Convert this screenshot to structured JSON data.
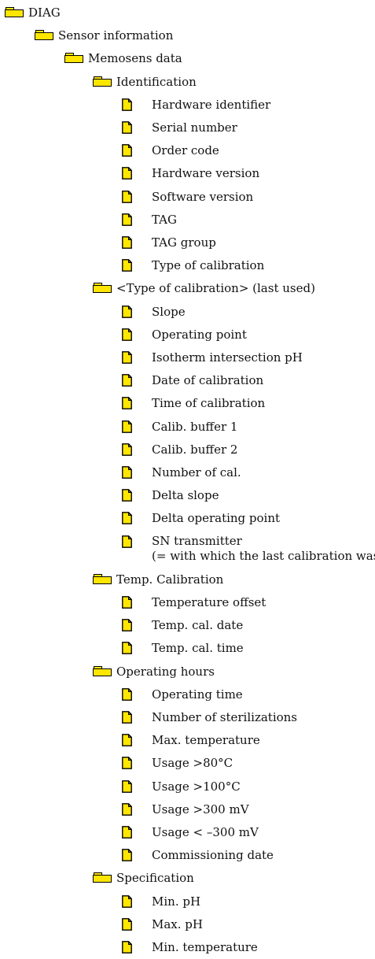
{
  "colors": {
    "folder_fill": "#ffe600",
    "file_fill": "#ffe600",
    "outline": "#000000"
  },
  "tree": [
    {
      "type": "folder",
      "level": 0,
      "label": "DIAG"
    },
    {
      "type": "folder",
      "level": 1,
      "label": "Sensor information"
    },
    {
      "type": "folder",
      "level": 2,
      "label": "Memosens data"
    },
    {
      "type": "folder",
      "level": 3,
      "label": "Identification"
    },
    {
      "type": "file",
      "level": 4,
      "label": "Hardware identifier"
    },
    {
      "type": "file",
      "level": 4,
      "label": "Serial number"
    },
    {
      "type": "file",
      "level": 4,
      "label": "Order code"
    },
    {
      "type": "file",
      "level": 4,
      "label": "Hardware version"
    },
    {
      "type": "file",
      "level": 4,
      "label": "Software version"
    },
    {
      "type": "file",
      "level": 4,
      "label": "TAG"
    },
    {
      "type": "file",
      "level": 4,
      "label": "TAG group"
    },
    {
      "type": "file",
      "level": 4,
      "label": "Type of calibration"
    },
    {
      "type": "folder",
      "level": 3,
      "label": "<Type of calibration> (last used)"
    },
    {
      "type": "file",
      "level": 4,
      "label": "Slope"
    },
    {
      "type": "file",
      "level": 4,
      "label": "Operating point"
    },
    {
      "type": "file",
      "level": 4,
      "label": "Isotherm intersection pH"
    },
    {
      "type": "file",
      "level": 4,
      "label": "Date of calibration"
    },
    {
      "type": "file",
      "level": 4,
      "label": "Time of calibration"
    },
    {
      "type": "file",
      "level": 4,
      "label": "Calib. buffer 1"
    },
    {
      "type": "file",
      "level": 4,
      "label": "Calib. buffer 2"
    },
    {
      "type": "file",
      "level": 4,
      "label": "Number of cal."
    },
    {
      "type": "file",
      "level": 4,
      "label": "Delta slope"
    },
    {
      "type": "file",
      "level": 4,
      "label": "Delta operating point"
    },
    {
      "type": "file",
      "level": 4,
      "label": "SN transmitter",
      "label2": "(= with which the last calibration was)"
    },
    {
      "type": "folder",
      "level": 3,
      "label": "Temp. Calibration"
    },
    {
      "type": "file",
      "level": 4,
      "label": "Temperature offset"
    },
    {
      "type": "file",
      "level": 4,
      "label": "Temp. cal. date"
    },
    {
      "type": "file",
      "level": 4,
      "label": "Temp. cal. time"
    },
    {
      "type": "folder",
      "level": 3,
      "label": "Operating hours"
    },
    {
      "type": "file",
      "level": 4,
      "label": "Operating time"
    },
    {
      "type": "file",
      "level": 4,
      "label": "Number of sterilizations"
    },
    {
      "type": "file",
      "level": 4,
      "label": "Max. temperature"
    },
    {
      "type": "file",
      "level": 4,
      "label": "Usage >80°C"
    },
    {
      "type": "file",
      "level": 4,
      "label": "Usage >100°C"
    },
    {
      "type": "file",
      "level": 4,
      "label": "Usage >300 mV"
    },
    {
      "type": "file",
      "level": 4,
      "label": "Usage < –300 mV"
    },
    {
      "type": "file",
      "level": 4,
      "label": "Commissioning date"
    },
    {
      "type": "folder",
      "level": 3,
      "label": "Specification"
    },
    {
      "type": "file",
      "level": 4,
      "label": "Min. pH"
    },
    {
      "type": "file",
      "level": 4,
      "label": "Max. pH"
    },
    {
      "type": "file",
      "level": 4,
      "label": "Min. temperature"
    }
  ]
}
